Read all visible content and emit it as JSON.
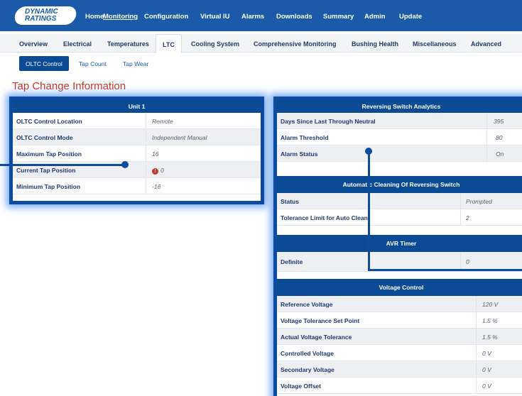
{
  "logo": {
    "line1": "DYNAMIC",
    "line2": "RATINGS"
  },
  "topnav": [
    "Home",
    "Monitoring",
    "Configuration",
    "Virtual IU",
    "Alarms",
    "Downloads",
    "Summary",
    "Admin",
    "Update"
  ],
  "topnav_active": "Monitoring",
  "tabs": [
    "Overview",
    "Electrical",
    "Temperatures",
    "LTC",
    "Cooling System",
    "Comprehensive Monitoring",
    "Bushing Health",
    "Miscellaneous",
    "Advanced"
  ],
  "tabs_active": "LTC",
  "subtabs": [
    "OLTC Control",
    "Tap Count",
    "Tap Wear"
  ],
  "subtabs_active": "OLTC Control",
  "page_title": "Tap Change Information",
  "unit1": {
    "title": "Unit 1",
    "rows": [
      {
        "label": "OLTC Control Location",
        "value": "Remote"
      },
      {
        "label": "OLTC Control Mode",
        "value": "Independent Manual"
      },
      {
        "label": "Maximum Tap Position",
        "value": "16"
      },
      {
        "label": "Current Tap Position",
        "value": "0",
        "alert": "!"
      },
      {
        "label": "Minimum Tap Position",
        "value": "-16"
      }
    ]
  },
  "reversing": {
    "title": "Reversing Switch Analytics",
    "rows": [
      {
        "label": "Days Since Last Through Neutral",
        "value": "395"
      },
      {
        "label": "Alarm Threshold",
        "value": "80"
      },
      {
        "label": "Alarm Status",
        "value": "On"
      }
    ]
  },
  "auto_clean": {
    "title": "Automat c Cleaning Of Reversing Switch",
    "rows": [
      {
        "label": "Status",
        "value": "Prompted"
      },
      {
        "label": "Tolerance Limit for Auto Clean",
        "value": "2"
      }
    ]
  },
  "avr_timer": {
    "title": "AVR Timer",
    "rows": [
      {
        "label": "Definite",
        "value": "0"
      }
    ]
  },
  "voltage_control": {
    "title": "Voltage Control",
    "rows": [
      {
        "label": "Reference Voltage",
        "value": "120 V"
      },
      {
        "label": "Voltage Tolerance Set Point",
        "value": "1.5 %"
      },
      {
        "label": "Actual Voltage Tolerance",
        "value": "1.5 %"
      },
      {
        "label": "Controlled Voltage",
        "value": "0 V"
      },
      {
        "label": "Secondary Voltage",
        "value": "0 V"
      },
      {
        "label": "Voltage Offset",
        "value": "0 V"
      }
    ]
  },
  "colors": {
    "navbar": "#1a5aa8",
    "header": "#0b4a94",
    "accent": "#c8372d",
    "highlight": "#0d4ba0"
  }
}
